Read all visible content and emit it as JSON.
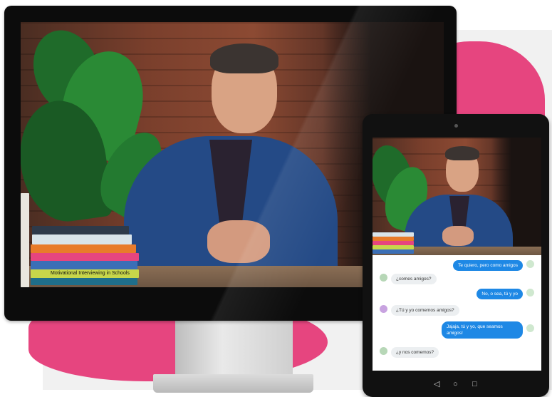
{
  "colors": {
    "accent_pink": "#e6457f",
    "bubble_blue": "#1e88e5",
    "bubble_gray": "#eceff1",
    "device_black": "#0c0c0c"
  },
  "book_spine": "Motivational Interviewing in Schools",
  "chat": {
    "messages": [
      {
        "side": "right",
        "text": "Te quiero, pero como amigos"
      },
      {
        "side": "left",
        "text": "¿comes amigos?"
      },
      {
        "side": "right",
        "text": "No, o sea, tú y yo"
      },
      {
        "side": "left",
        "text": "¿Tú y yo comemos amigos?"
      },
      {
        "side": "right",
        "text": "Jajaja, tú y yo, que seamos amigos!"
      },
      {
        "side": "left",
        "text": "¿y nos comemos?"
      }
    ]
  },
  "tablet_nav": {
    "back_icon": "back-icon",
    "home_icon": "home-icon",
    "recents_icon": "recents-icon"
  }
}
